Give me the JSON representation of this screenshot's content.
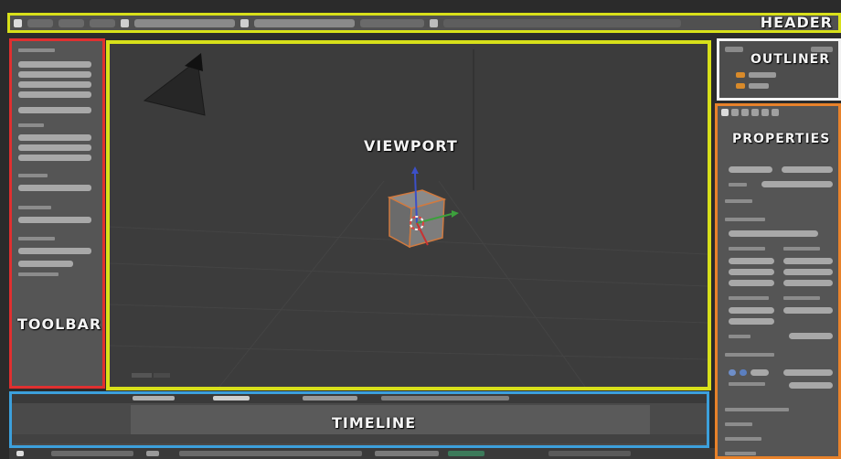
{
  "labels": {
    "header": "HEADER",
    "toolbar": "TOOLBAR",
    "viewport": "VIEWPORT",
    "outliner": "OUTLINER",
    "properties": "PROPERTIES",
    "timeline": "TIMELINE"
  },
  "colors": {
    "header_border": "#d8e01a",
    "toolbar_border": "#e03030",
    "viewport_border": "#d8e01a",
    "outliner_border": "#f2f2f2",
    "properties_border": "#e8822a",
    "timeline_border": "#3ca0dc",
    "axis_x": "#c83232",
    "axis_y": "#3ca03c",
    "axis_z": "#3c50c8"
  },
  "icons": [
    "camera-object",
    "selected-cube",
    "3d-cursor",
    "transform-gizmo"
  ]
}
